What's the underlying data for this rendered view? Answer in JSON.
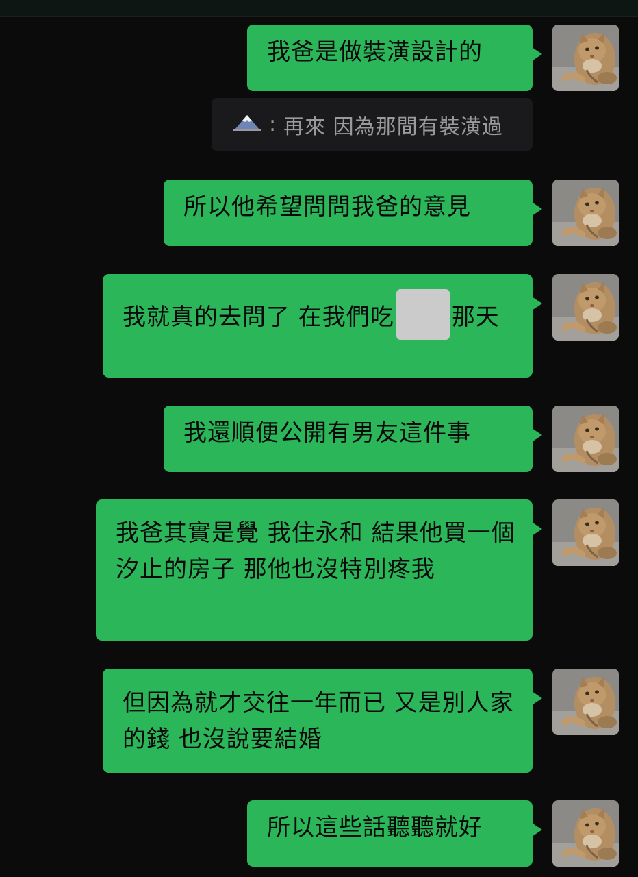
{
  "messages": [
    {
      "text": "我爸是做裝潢設計的"
    },
    {
      "quote_sender": "🗻",
      "quote_text": "再來 因為那間有裝潢過"
    },
    {
      "text": "所以他希望問問我爸的意見"
    },
    {
      "text_before": "我就真的去問了 在我們吃",
      "text_after": "那天"
    },
    {
      "text": "我還順便公開有男友這件事"
    },
    {
      "text": "我爸其實是覺 我住永和 結果他買一個汐止的房子 那他也沒特別疼我"
    },
    {
      "text": "但因為就才交往一年而已 又是別人家的錢 也沒說要結婚"
    },
    {
      "text": "所以這些話聽聽就好"
    }
  ],
  "avatar_icon": "cat-avatar",
  "colors": {
    "background": "#0b0b0c",
    "bubble": "#2bb659",
    "reply_bg": "#1a1a1c",
    "reply_text": "#9a9a9c"
  }
}
